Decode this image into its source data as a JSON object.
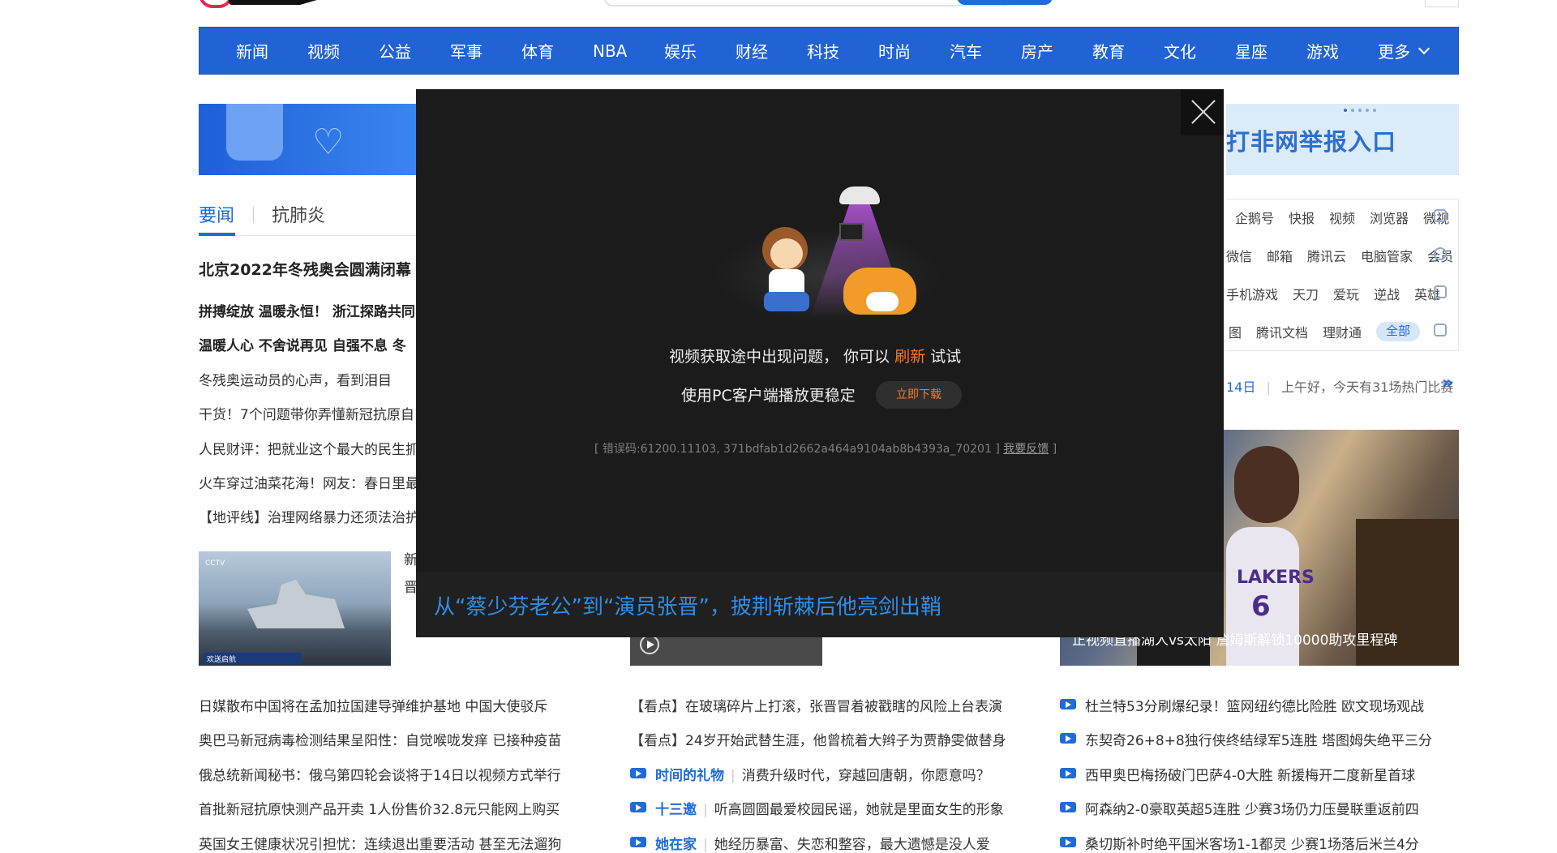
{
  "nav": {
    "items": [
      "新闻",
      "视频",
      "公益",
      "军事",
      "体育",
      "NBA",
      "娱乐",
      "财经",
      "科技",
      "时尚",
      "汽车",
      "房产",
      "教育",
      "文化",
      "星座",
      "游戏"
    ],
    "more_label": "更多"
  },
  "banner_right": {
    "title": "打非网举报入口"
  },
  "tabs": [
    "要闻",
    "抗肺炎"
  ],
  "left_news": {
    "headline": "北京2022年冬残奥会圆满闭幕",
    "bold": [
      "拼搏绽放 温暖永恒！ 浙江探路共同",
      "温暖人心 不舍说再见 自强不息 冬"
    ],
    "items": [
      "冬残奥运动员的心声，看到泪目",
      "干货！7个问题带你弄懂新冠抗原自",
      "人民财评：把就业这个最大的民生抓",
      "火车穿过油菜花海！网友：春日里最",
      "【地评线】治理网络暴力还须法治护"
    ],
    "thumb_side": [
      "新",
      "晋"
    ],
    "thumb_bar": "欢送启航"
  },
  "right_photo": {
    "caption": "正视频直播湖人vs太阳 詹姆斯解锁10000助攻里程碑",
    "jersey": "LAKERS",
    "number": "6"
  },
  "services": {
    "row1": [
      "企鹅号",
      "快报",
      "视频",
      "浏览器",
      "微视"
    ],
    "row2": [
      "微信",
      "邮箱",
      "腾讯云",
      "电脑管家",
      "会员"
    ],
    "row3": [
      "手机游戏",
      "天刀",
      "爱玩",
      "逆战",
      "英雄"
    ],
    "row4": [
      "图",
      "腾讯文档",
      "理财通"
    ],
    "all_label": "全部"
  },
  "date_line": {
    "date": "14日",
    "greeting": "上午好，今天有31场热门比赛"
  },
  "bottom": {
    "col1": [
      "日媒散布中国将在孟加拉国建导弹维护基地 中国大使驳斥",
      "奥巴马新冠病毒检测结果呈阳性：自觉喉咙发痒 已接种疫苗",
      "俄总统新闻秘书：俄乌第四轮会谈将于14日以视频方式举行",
      "首批新冠抗原快测产品开卖 1人份售价32.8元只能网上购买",
      "英国女王健康状况引担忧：连续退出重要活动 甚至无法遛狗"
    ],
    "col2_plain": [
      "【看点】在玻璃碎片上打滚，张晋冒着被戳瞎的风险上台表演",
      "【看点】24岁开始武替生涯，他曾梳着大辫子为贾静雯做替身"
    ],
    "col2_tagged": [
      {
        "tag": "时间的礼物",
        "text": "消费升级时代，穿越回唐朝，你愿意吗？"
      },
      {
        "tag": "十三邀",
        "text": "听高圆圆最爱校园民谣，她就是里面女生的形象"
      },
      {
        "tag": "她在家",
        "text": "她经历暴富、失恋和整容，最大遗憾是没人爱"
      }
    ],
    "col3": [
      "杜兰特53分刷爆纪录！篮网纽约德比险胜 欧文现场观战",
      "东契奇26+8+8独行侠终结绿军5连胜 塔图姆失绝平三分",
      "西甲奥巴梅扬破门巴萨4-0大胜 新援梅开二度新星首球",
      "阿森纳2-0豪取英超5连胜 少赛3场仍力压曼联重返前四",
      "桑切斯补时绝平国米客场1-1都灵 少赛1场落后米兰4分"
    ]
  },
  "modal": {
    "line1_pre": "视频获取途中出现问题， 你可以 ",
    "refresh": "刷新",
    "line1_post": " 试试",
    "line2": "使用PC客户端播放更稳定",
    "download": "立即下载",
    "error": "[ 错误码:61200.11103, 371bdfab1d2662a464a9104ab8b4393a_70201 ] ",
    "feedback": "我要反馈",
    "title": "从“蔡少芬老公”到“演员张晋”，披荆斩棘后他亮剑出鞘"
  }
}
